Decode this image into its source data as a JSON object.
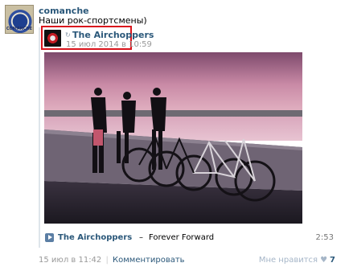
{
  "post": {
    "author": "comanche",
    "text": "Наши рок-спортсмены)",
    "avatar_label": "COMANCHE"
  },
  "repost": {
    "source_name": "The Airchoppers",
    "date": "15 июл 2014 в 10:59",
    "repost_icon": "repost-arrow-icon"
  },
  "photo": {
    "alt": "Photo: band members with bicycles at sunset by the river"
  },
  "audio": {
    "artist": "The Airchoppers",
    "separator": "–",
    "title": "Forever Forward",
    "duration": "2:53"
  },
  "footer": {
    "date": "15 июл в 11:42",
    "divider": "|",
    "comment_label": "Комментировать",
    "like_label": "Мне нравится",
    "like_count": "7"
  },
  "colors": {
    "link": "#2b587a",
    "highlight": "#d9141c",
    "meta": "#999999"
  }
}
